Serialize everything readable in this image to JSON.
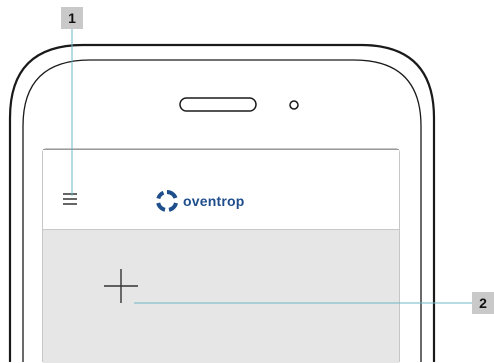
{
  "callouts": [
    {
      "label": "1"
    },
    {
      "label": "2"
    }
  ],
  "app": {
    "brand": "oventrop",
    "icons": {
      "menu": "hamburger-menu-icon",
      "logo": "oventrop-logo-icon",
      "add": "plus-icon"
    }
  },
  "colors": {
    "callout_bg": "#c9c9c9",
    "callout_line": "#6fb7c4",
    "brand_blue": "#1f4e8c",
    "content_bg": "#e6e6e6"
  }
}
